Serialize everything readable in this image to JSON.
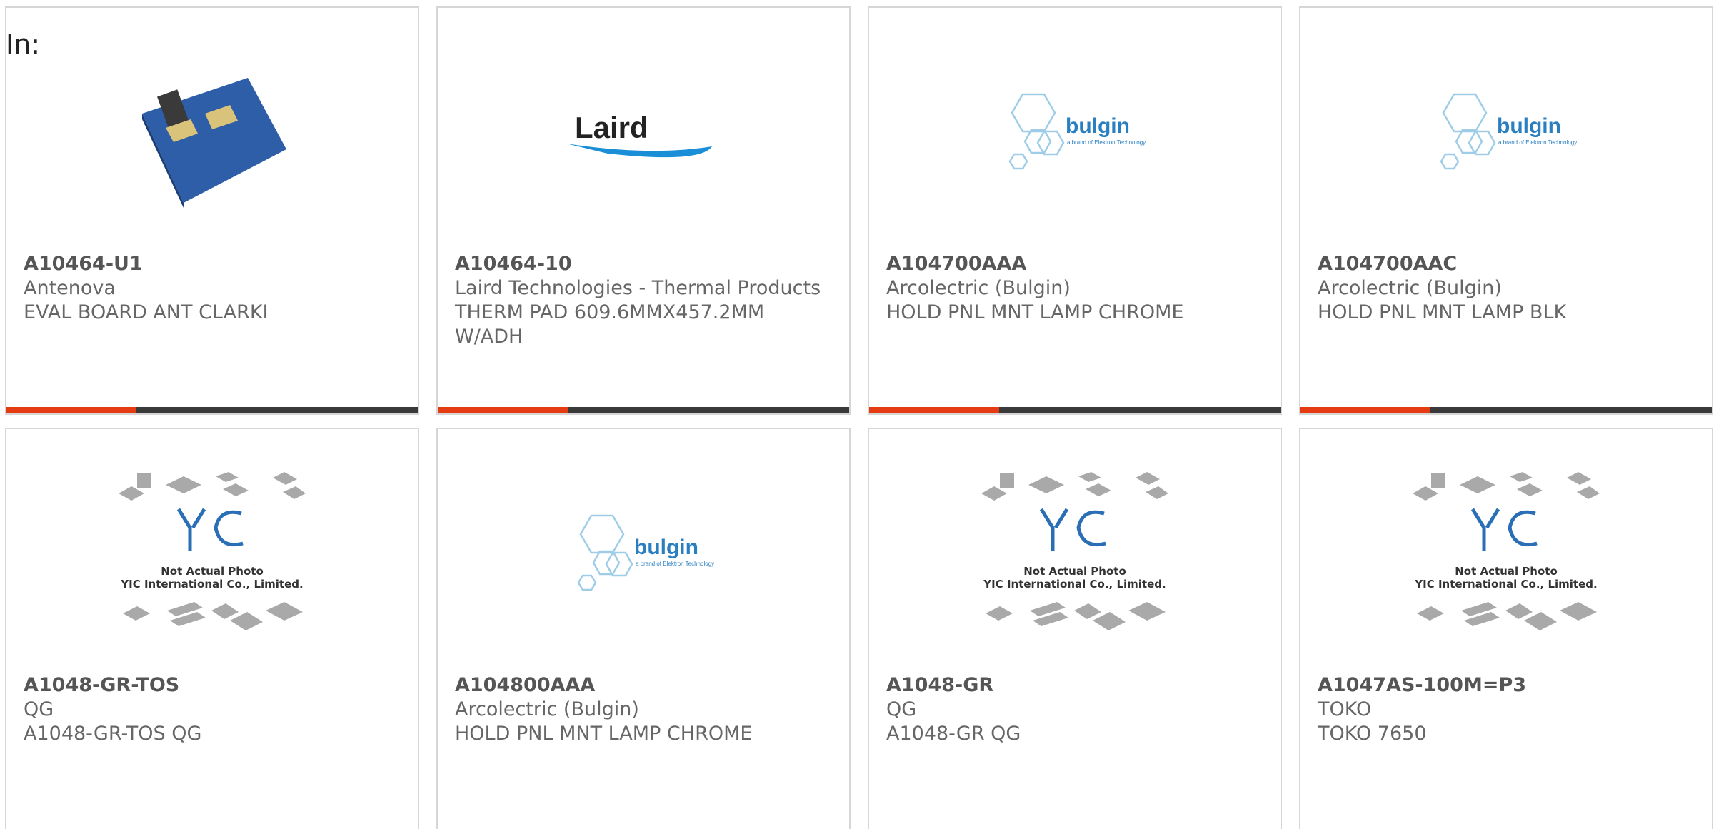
{
  "header": {
    "in_label": "In:"
  },
  "products": [
    {
      "part_number": "A10464-U1",
      "manufacturer": "Antenova",
      "description": "EVAL BOARD ANT CLARKI",
      "image": "antenna-board-photo"
    },
    {
      "part_number": "A10464-10",
      "manufacturer": "Laird Technologies - Thermal Products",
      "description": "THERM PAD 609.6MMX457.2MM W/ADH",
      "image": "laird-logo",
      "logo_text": "Laird"
    },
    {
      "part_number": "A104700AAA",
      "manufacturer": "Arcolectric (Bulgin)",
      "description": "HOLD PNL MNT LAMP CHROME",
      "image": "bulgin-logo",
      "logo_text": "bulgin",
      "logo_subtext": "a brand of Elektron Technology"
    },
    {
      "part_number": "A104700AAC",
      "manufacturer": "Arcolectric (Bulgin)",
      "description": "HOLD PNL MNT LAMP BLK",
      "image": "bulgin-logo",
      "logo_text": "bulgin",
      "logo_subtext": "a brand of Elektron Technology"
    },
    {
      "part_number": "A1048-GR-TOS",
      "manufacturer": "QG",
      "description": "A1048-GR-TOS QG",
      "image": "yic-placeholder",
      "placeholder_line1": "Not Actual Photo",
      "placeholder_line2": "YIC International Co., Limited."
    },
    {
      "part_number": "A104800AAA",
      "manufacturer": "Arcolectric (Bulgin)",
      "description": "HOLD PNL MNT LAMP CHROME",
      "image": "bulgin-logo",
      "logo_text": "bulgin",
      "logo_subtext": "a brand of Elektron Technology"
    },
    {
      "part_number": "A1048-GR",
      "manufacturer": "QG",
      "description": "A1048-GR QG",
      "image": "yic-placeholder",
      "placeholder_line1": "Not Actual Photo",
      "placeholder_line2": "YIC International Co., Limited."
    },
    {
      "part_number": "A1047AS-100M=P3",
      "manufacturer": "TOKO",
      "description": "TOKO 7650",
      "image": "yic-placeholder",
      "placeholder_line1": "Not Actual Photo",
      "placeholder_line2": "YIC International Co., Limited."
    }
  ],
  "colors": {
    "accent": "#e43b13",
    "bar": "#3a3a3a",
    "bulgin": "#2a7fc1",
    "laird": "#222222"
  }
}
